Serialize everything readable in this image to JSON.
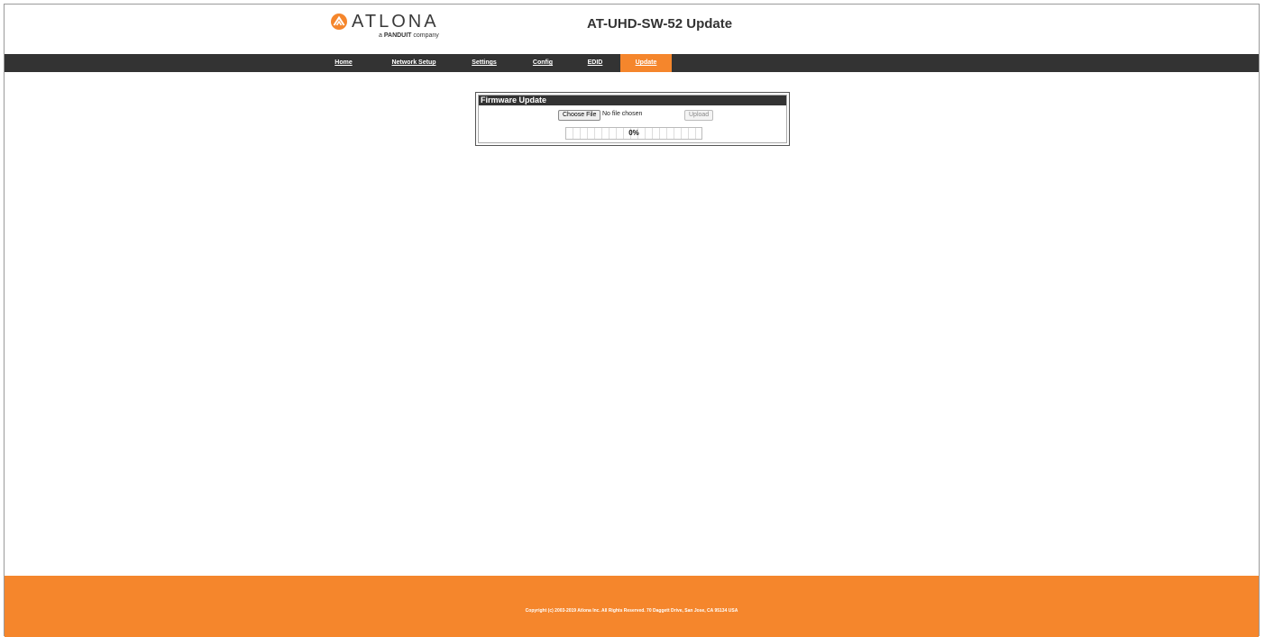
{
  "header": {
    "logo_text": "ATLONA",
    "logo_sub_prefix": "a",
    "logo_sub_brand": "PANDUIT",
    "logo_sub_suffix": "company",
    "title": "AT-UHD-SW-52 Update"
  },
  "nav": {
    "items": [
      {
        "label": "Home",
        "active": false
      },
      {
        "label": "Network Setup",
        "active": false
      },
      {
        "label": "Settings",
        "active": false
      },
      {
        "label": "Config",
        "active": false
      },
      {
        "label": "EDID",
        "active": false
      },
      {
        "label": "Update",
        "active": true
      }
    ]
  },
  "firmware": {
    "title": "Firmware Update",
    "choose_label": "Choose File",
    "file_status": "No file chosen",
    "upload_label": "Upload",
    "progress_text": "0%",
    "progress_fraction": 0
  },
  "footer": {
    "copyright": "Copyright (c) 2003-2019 Atlona Inc. All Rights Reserved. 70 Daggett Drive, San Jose, CA 95134 USA"
  },
  "colors": {
    "accent": "#f5862c",
    "navbar": "#333333"
  },
  "icons": {
    "logo": "atlona-logo-icon"
  }
}
